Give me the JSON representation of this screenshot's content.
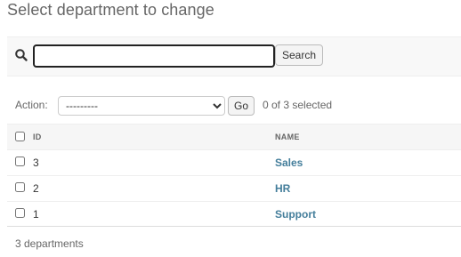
{
  "header": {
    "title": "Select department to change"
  },
  "search": {
    "value": "",
    "button_label": "Search"
  },
  "actions": {
    "label": "Action:",
    "selected_option": "---------",
    "options": [
      "---------"
    ],
    "go_label": "Go",
    "selected_count": "0 of 3 selected"
  },
  "table": {
    "columns": [
      "ID",
      "NAME"
    ],
    "rows": [
      {
        "id": "3",
        "name": "Sales"
      },
      {
        "id": "2",
        "name": "HR"
      },
      {
        "id": "1",
        "name": "Support"
      }
    ]
  },
  "paginator": {
    "text": "3 departments"
  },
  "colors": {
    "link": "#447e9b",
    "toolbar_bg": "#f8f8f8"
  }
}
